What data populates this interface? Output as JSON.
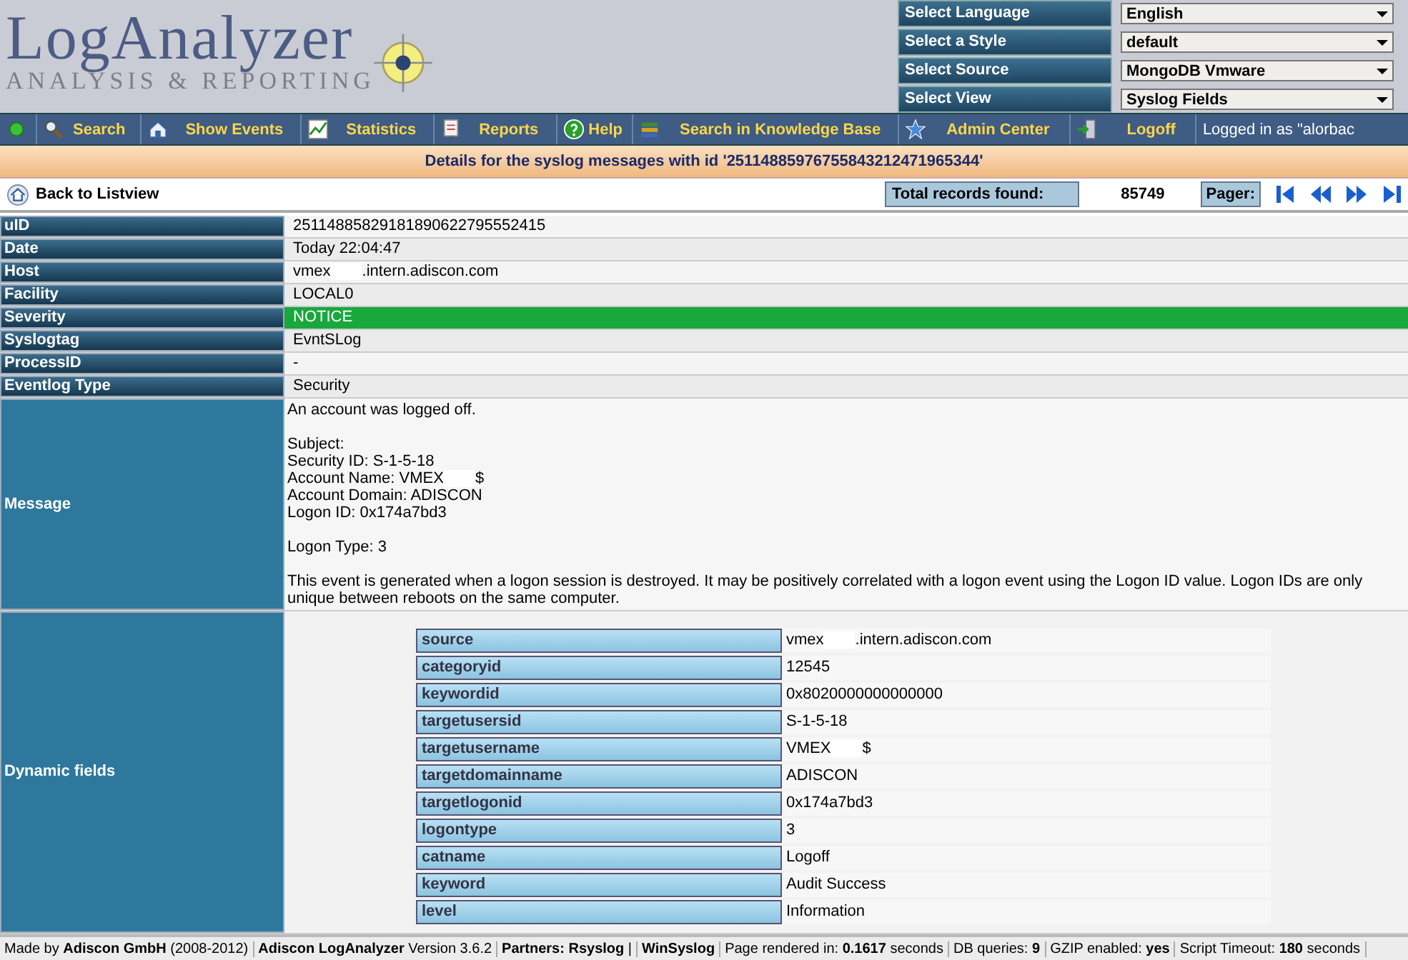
{
  "logo": {
    "title": "LogAnalyzer",
    "subtitle": "ANALYSIS & REPORTING"
  },
  "selectors": [
    {
      "label": "Select Language",
      "value": "English"
    },
    {
      "label": "Select a Style",
      "value": "default"
    },
    {
      "label": "Select Source",
      "value": "MongoDB Vmware"
    },
    {
      "label": "Select View",
      "value": "Syslog Fields"
    }
  ],
  "nav": [
    {
      "kind": "status"
    },
    {
      "kind": "search",
      "label": "Search"
    },
    {
      "kind": "events",
      "label": "Show Events"
    },
    {
      "kind": "chart",
      "label": "Statistics"
    },
    {
      "kind": "report",
      "label": "Reports"
    },
    {
      "kind": "help",
      "label": "Help"
    },
    {
      "kind": "books",
      "label": "Search in Knowledge Base"
    },
    {
      "kind": "star",
      "label": "Admin Center"
    },
    {
      "kind": "exit",
      "label": "Logoff"
    }
  ],
  "logged_in": "Logged in as \"alorbac",
  "title": "Details for the syslog messages with id '25114885976755843212471965344'",
  "toolbar": {
    "back": "Back to Listview",
    "total_label": "Total records found:",
    "total": "85749",
    "pager_label": "Pager:"
  },
  "fields": [
    {
      "label": "uID",
      "kind": "text",
      "value": "25114885829181890622795552415"
    },
    {
      "label": "Date",
      "kind": "text",
      "value": "Today 22:04:47"
    },
    {
      "label": "Host",
      "kind": "redacted",
      "parts": [
        "vmex",
        ".intern.adiscon.com"
      ]
    },
    {
      "label": "Facility",
      "kind": "text",
      "value": "LOCAL0"
    },
    {
      "label": "Severity",
      "kind": "text",
      "value": "NOTICE",
      "color": "#18a83c"
    },
    {
      "label": "Syslogtag",
      "kind": "text",
      "value": "EvntSLog"
    },
    {
      "label": "ProcessID",
      "kind": "text",
      "value": "-"
    },
    {
      "label": "Eventlog Type",
      "kind": "text",
      "value": "Security"
    },
    {
      "label": "Message",
      "kind": "lines",
      "lines": [
        {
          "kind": "text",
          "value": " An account was logged off."
        },
        {
          "kind": "blank"
        },
        {
          "kind": "text",
          "value": "Subject:"
        },
        {
          "kind": "text",
          "value": "Security ID: S-1-5-18"
        },
        {
          "kind": "redacted",
          "parts": [
            "Account Name: VMEX",
            "$"
          ]
        },
        {
          "kind": "text",
          "value": "Account Domain: ADISCON"
        },
        {
          "kind": "text",
          "value": "Logon ID: 0x174a7bd3"
        },
        {
          "kind": "blank"
        },
        {
          "kind": "text",
          "value": "Logon Type: 3"
        },
        {
          "kind": "blank"
        },
        {
          "kind": "text",
          "value": "This event is generated when a logon session is destroyed. It may be positively correlated with a logon event using the Logon ID value. Logon IDs are only unique between reboots on the same computer."
        }
      ]
    },
    {
      "label": "Dynamic fields",
      "kind": "dynamic",
      "items": [
        {
          "name": "source",
          "kind": "redacted",
          "parts": [
            "vmex",
            ".intern.adiscon.com"
          ]
        },
        {
          "name": "categoryid",
          "kind": "text",
          "value": "12545"
        },
        {
          "name": "keywordid",
          "kind": "text",
          "value": "0x8020000000000000"
        },
        {
          "name": "targetusersid",
          "kind": "text",
          "value": "S-1-5-18"
        },
        {
          "name": "targetusername",
          "kind": "redacted",
          "parts": [
            "VMEX",
            "$"
          ]
        },
        {
          "name": "targetdomainname",
          "kind": "text",
          "value": "ADISCON"
        },
        {
          "name": "targetlogonid",
          "kind": "text",
          "value": "0x174a7bd3"
        },
        {
          "name": "logontype",
          "kind": "text",
          "value": "3"
        },
        {
          "name": "catname",
          "kind": "text",
          "value": "Logoff"
        },
        {
          "name": "keyword",
          "kind": "text",
          "value": "Audit Success"
        },
        {
          "name": "level",
          "kind": "text",
          "value": "Information"
        }
      ]
    }
  ],
  "footer": [
    "Made by **Adiscon GmbH** (2008-2012)",
    "**Adiscon LogAnalyzer** Version 3.6.2",
    "**Partners:** **Rsyslog** |",
    "**WinSyslog**",
    "Page rendered in: **0.1617** seconds",
    "DB queries: **9**",
    "GZIP enabled: **yes**",
    "Script Timeout: **180** seconds"
  ]
}
